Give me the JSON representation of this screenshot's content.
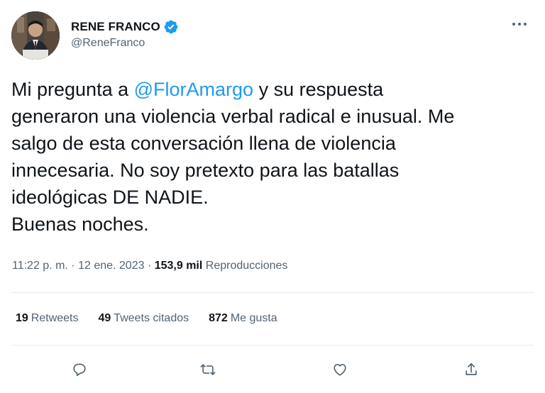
{
  "author": {
    "display_name": "RENE FRANCO",
    "handle": "@ReneFranco",
    "verified": true
  },
  "tweet": {
    "text_before": "Mi pregunta a ",
    "mention": "@FlorAmargo",
    "text_after": " y su respuesta\ngeneraron una violencia verbal radical e inusual. Me\nsalgo de esta conversación llena de violencia\ninnecesaria. No soy pretexto para las batallas\nideológicas DE NADIE.\nBuenas noches."
  },
  "meta": {
    "time": "11:22 p. m.",
    "separator": " · ",
    "date": "12 ene. 2023",
    "views_count": "153,9 mil",
    "views_label": " Reproducciones"
  },
  "stats": {
    "retweets_count": "19",
    "retweets_label": "Retweets",
    "quotes_count": "49",
    "quotes_label": "Tweets citados",
    "likes_count": "872",
    "likes_label": "Me gusta"
  },
  "icons": {
    "more": "more-icon",
    "reply": "reply-icon",
    "retweet": "retweet-icon",
    "like": "like-icon",
    "share": "share-icon",
    "verified": "verified-badge-icon"
  },
  "colors": {
    "text": "#0f1419",
    "secondary": "#536471",
    "accent": "#1d9bf0",
    "divider": "#e6ecf0"
  }
}
